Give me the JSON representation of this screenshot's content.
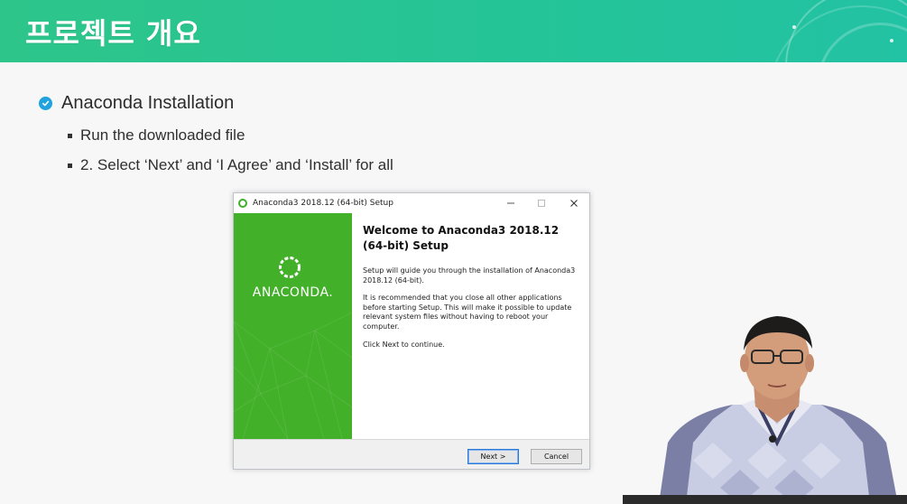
{
  "header": {
    "title": "프로젝트 개요",
    "accent_color": "#2dc58a"
  },
  "content": {
    "heading": "Anaconda Installation",
    "heading_icon": "check-circle-icon",
    "bullets": [
      "Run the downloaded file",
      "2. Select ‘Next’ and ‘I Agree’ and ‘Install’ for all"
    ]
  },
  "dialog": {
    "title": "Anaconda3 2018.12 (64-bit) Setup",
    "window_controls": [
      "minimize-icon",
      "maximize-icon",
      "close-icon"
    ],
    "logo_text": "ANACONDA.",
    "brand_color": "#43b02a",
    "welcome_title": "Welcome to Anaconda3 2018.12 (64-bit) Setup",
    "paragraphs": [
      "Setup will guide you through the installation of Anaconda3 2018.12 (64-bit).",
      "It is recommended that you close all other applications before starting Setup. This will make it possible to update relevant system files without having to reboot your computer.",
      "Click Next to continue."
    ],
    "buttons": {
      "next": "Next >",
      "cancel": "Cancel"
    }
  }
}
